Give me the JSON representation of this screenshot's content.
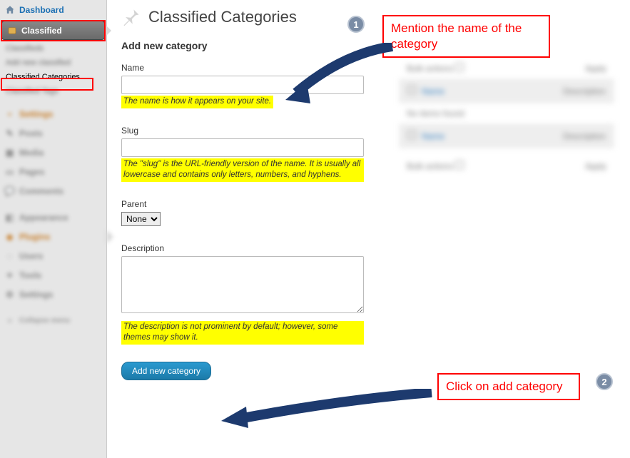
{
  "sidebar": {
    "dashboard": "Dashboard",
    "classified": "Classified",
    "sub_classifieds": "Classifieds",
    "sub_addnew": "Add new classified",
    "sub_categories": "Classified Categories",
    "sub_tags": "Classified Tags",
    "settings": "Settings",
    "posts": "Posts",
    "media": "Media",
    "pages": "Pages",
    "comments": "Comments",
    "appearance": "Appearance",
    "plugins": "Plugins",
    "users": "Users",
    "tools": "Tools",
    "settings2": "Settings",
    "collapse": "Collapse menu"
  },
  "page": {
    "title": "Classified Categories",
    "section": "Add new category"
  },
  "fields": {
    "name_label": "Name",
    "name_hint": "The name is how it appears on your site.",
    "slug_label": "Slug",
    "slug_hint": "The \"slug\" is the URL-friendly version of the name. It is usually all lowercase and contains only letters, numbers, and hyphens.",
    "parent_label": "Parent",
    "parent_value": "None",
    "description_label": "Description",
    "description_hint": "The description is not prominent by default; however, some themes may show it."
  },
  "button": {
    "add": "Add new category"
  },
  "annotations": {
    "callout1": "Mention the name of the category",
    "callout2": "Click on add category",
    "badge1": "1",
    "badge2": "2"
  },
  "right": {
    "bulk": "Bulk actions",
    "apply": "Apply",
    "name_col": "Name",
    "desc_col": "Description",
    "no_items": "No items found"
  }
}
